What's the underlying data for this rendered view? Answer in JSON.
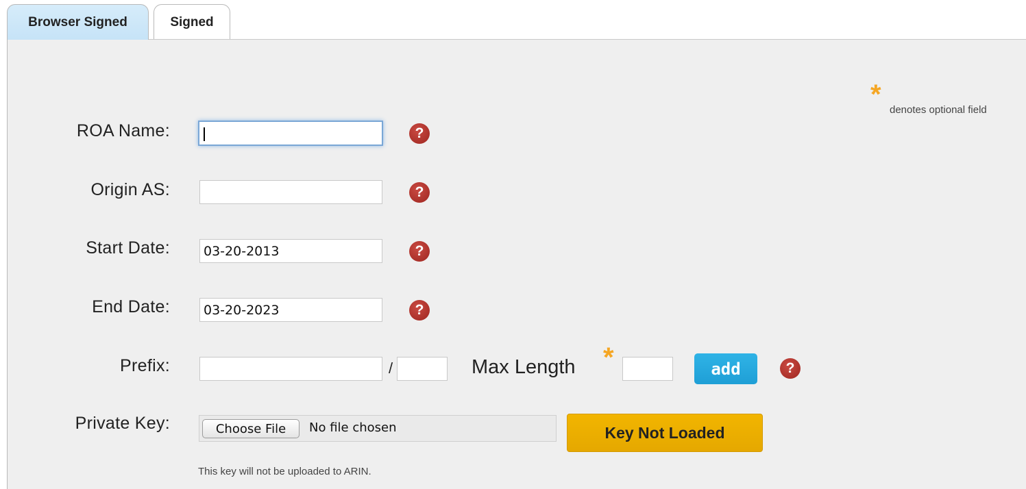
{
  "tabs": [
    {
      "label": "Browser Signed",
      "active": true
    },
    {
      "label": "Signed",
      "active": false
    }
  ],
  "optional_note": {
    "star": "*",
    "text": "denotes optional field"
  },
  "form": {
    "roa_name": {
      "label": "ROA Name:",
      "value": "",
      "help": "?"
    },
    "origin_as": {
      "label": "Origin AS:",
      "value": "",
      "help": "?"
    },
    "start_date": {
      "label": "Start Date:",
      "value": "03-20-2013",
      "help": "?"
    },
    "end_date": {
      "label": "End Date:",
      "value": "03-20-2023",
      "help": "?"
    },
    "prefix": {
      "label": "Prefix:",
      "value": "",
      "separator": "/",
      "length_value": "",
      "max_length_label": "Max Length",
      "max_length_star": "*",
      "max_length_value": "",
      "add_label": "add",
      "help": "?"
    },
    "private_key": {
      "label": "Private Key:",
      "choose_label": "Choose File",
      "file_status": "No file chosen",
      "key_status_label": "Key Not Loaded",
      "note": "This key will not be uploaded to ARIN."
    }
  },
  "colors": {
    "tab_active": "#c6e3f7",
    "panel_bg": "#efefef",
    "help_icon": "#a8302a",
    "add_button": "#25a8dd",
    "key_button": "#eab000",
    "optional_star": "#f5a623"
  }
}
